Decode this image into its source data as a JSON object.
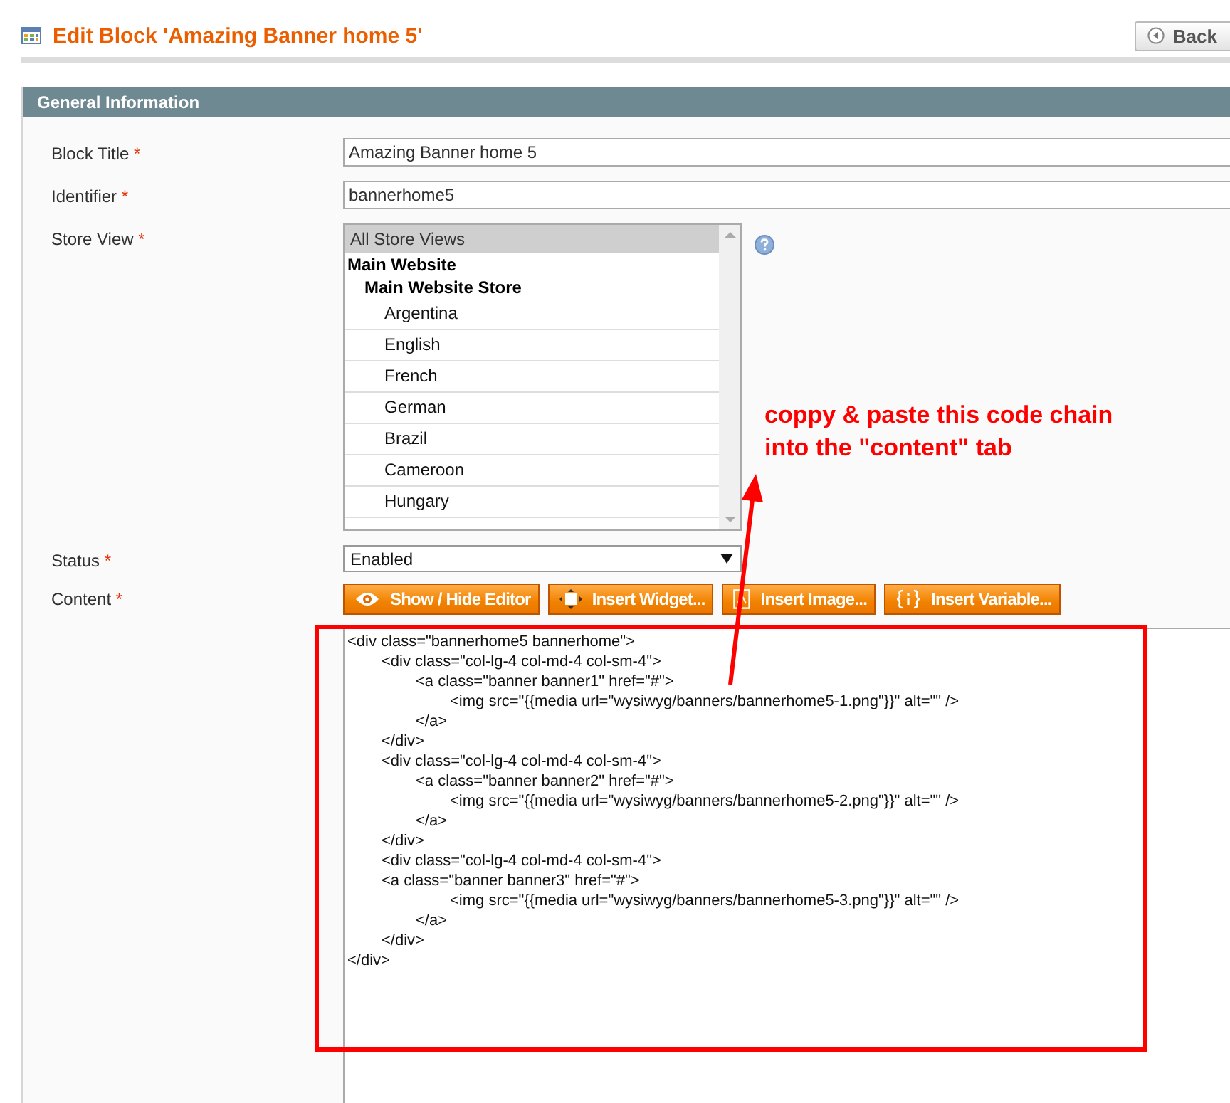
{
  "page_title": "Edit Block 'Amazing Banner home 5'",
  "back_button": "Back",
  "section": {
    "title": "General Information"
  },
  "fields": [
    {
      "label": "Block Title",
      "required_mark": "*",
      "kind": "text",
      "value": "Amazing Banner home 5"
    },
    {
      "label": "Identifier",
      "required_mark": "*",
      "kind": "text",
      "value": "bannerhome5"
    },
    {
      "label": "Store View",
      "required_mark": "*",
      "kind": "multiselect",
      "help": true,
      "options": [
        {
          "label": "All Store Views",
          "selected": true
        }
      ],
      "groups": [
        {
          "label": "Main Website",
          "children": [
            {
              "label": "Main Website Store",
              "children": [
                {
                  "label": "Argentina",
                  "selected": false
                },
                {
                  "label": "English",
                  "selected": false
                },
                {
                  "label": "French",
                  "selected": false
                },
                {
                  "label": "German",
                  "selected": false
                },
                {
                  "label": "Brazil",
                  "selected": false
                },
                {
                  "label": "Cameroon",
                  "selected": false
                },
                {
                  "label": "Hungary",
                  "selected": false
                }
              ]
            }
          ]
        }
      ]
    },
    {
      "label": "Status",
      "required_mark": "*",
      "kind": "select",
      "value": "Enabled"
    },
    {
      "label": "Content",
      "required_mark": "*",
      "kind": "editor",
      "buttons": [
        {
          "label": "Show / Hide Editor"
        },
        {
          "label": "Insert Widget..."
        },
        {
          "label": "Insert Image..."
        },
        {
          "label": "Insert Variable..."
        }
      ],
      "value": "<div class=\"bannerhome5 bannerhome\">\n\t<div class=\"col-lg-4 col-md-4 col-sm-4\">\n\t\t<a class=\"banner banner1\" href=\"#\">\n\t\t\t<img src=\"{{media url=\"wysiwyg/banners/bannerhome5-1.png\"}}\" alt=\"\" />\n\t\t</a>\n\t</div>\n\t<div class=\"col-lg-4 col-md-4 col-sm-4\">\n\t\t<a class=\"banner banner2\" href=\"#\">\n\t\t\t<img src=\"{{media url=\"wysiwyg/banners/bannerhome5-2.png\"}}\" alt=\"\" />\n\t\t</a>\n\t</div>\n\t<div class=\"col-lg-4 col-md-4 col-sm-4\">\n\t<a class=\"banner banner3\" href=\"#\">\n\t\t\t<img src=\"{{media url=\"wysiwyg/banners/bannerhome5-3.png\"}}\" alt=\"\" />\n\t\t</a>\n\t</div>\n</div>"
    }
  ],
  "annotation": {
    "lines": [
      "coppy & paste this code chain",
      "into the \"content\" tab"
    ]
  }
}
